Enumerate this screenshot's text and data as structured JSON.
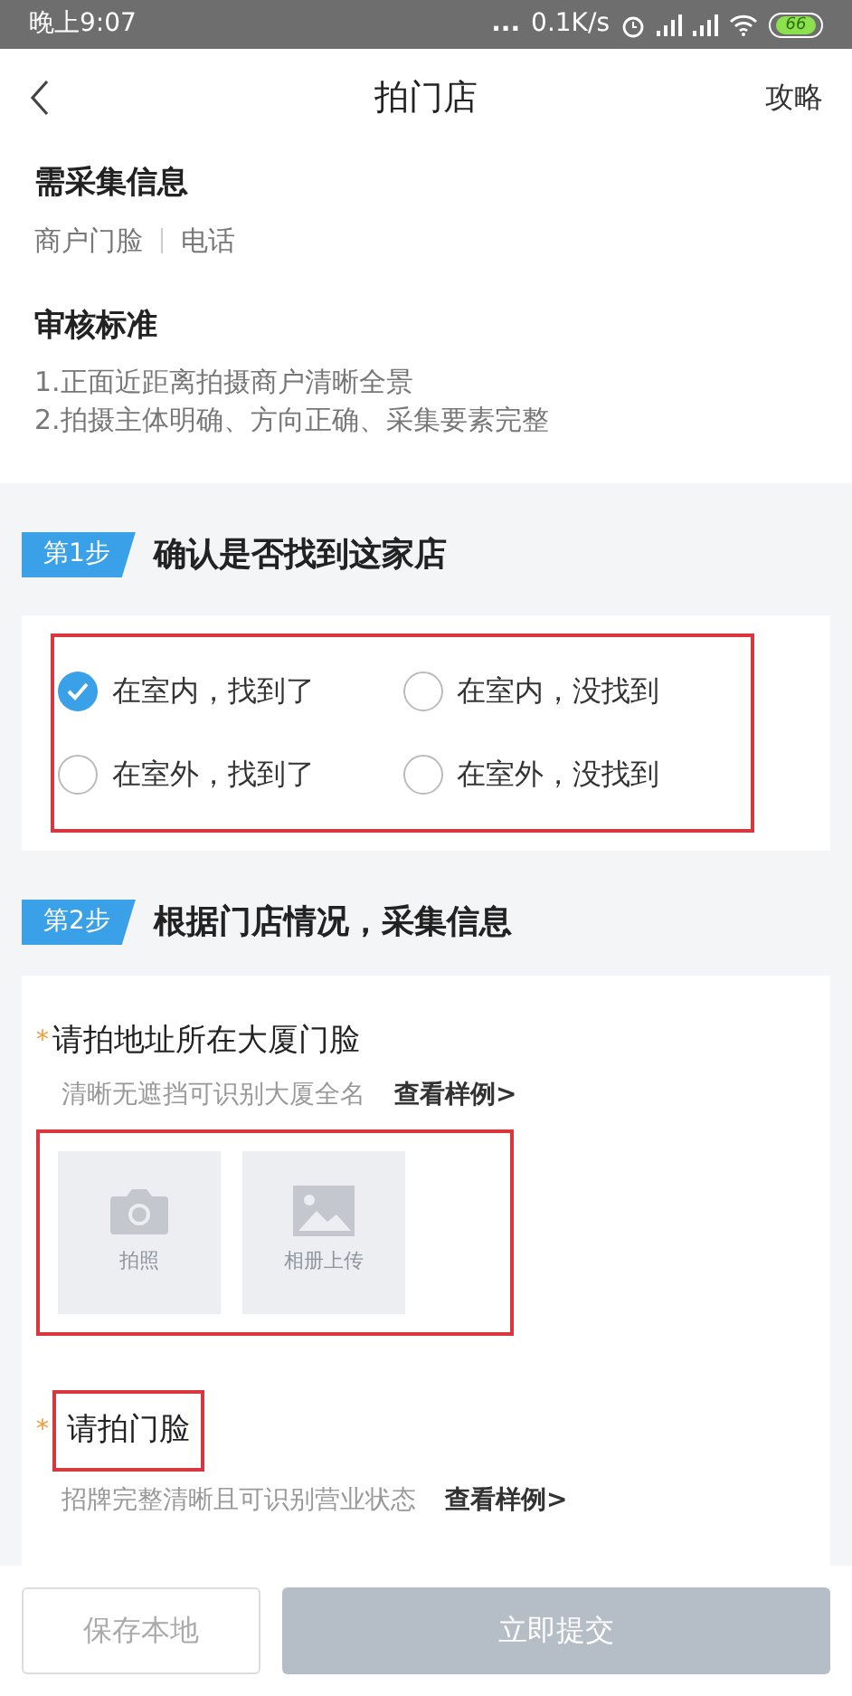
{
  "status_bar": {
    "time": "晚上9:07",
    "dots": "...",
    "speed": "0.1K/s",
    "battery": "66"
  },
  "nav": {
    "title": "拍门店",
    "action": "攻略"
  },
  "info": [
    {
      "title": "需采集信息",
      "kind": "tags",
      "tags": [
        "商户门脸",
        "电话"
      ]
    },
    {
      "title": "审核标准",
      "kind": "lines",
      "lines": [
        "1.正面近距离拍摄商户清晰全景",
        "2.拍摄主体明确、方向正确、采集要素完整"
      ]
    }
  ],
  "step1": {
    "badge": "第1步",
    "title": "确认是否找到这家店",
    "highlighted": true,
    "options": [
      {
        "label": "在室内，找到了",
        "selected": true
      },
      {
        "label": "在室内，没找到",
        "selected": false
      },
      {
        "label": "在室外，找到了",
        "selected": false
      },
      {
        "label": "在室外，没找到",
        "selected": false
      }
    ]
  },
  "step2": {
    "badge": "第2步",
    "title": "根据门店情况，采集信息",
    "tasks": [
      {
        "title": "请拍地址所在大厦门脸",
        "required_mark": "*",
        "title_highlighted": false,
        "hint": "清晰无遮挡可识别大厦全名",
        "link": "查看样例>",
        "uploads_highlighted": true,
        "uploads": [
          {
            "kind": "camera",
            "label": "拍照"
          },
          {
            "kind": "album",
            "label": "相册上传"
          }
        ]
      },
      {
        "title": "请拍门脸",
        "required_mark": "*",
        "title_highlighted": true,
        "hint": "招牌完整清晰且可识别营业状态",
        "link": "查看样例>"
      }
    ]
  },
  "footer": {
    "save": "保存本地",
    "submit": "立即提交",
    "submit_disabled": true
  }
}
